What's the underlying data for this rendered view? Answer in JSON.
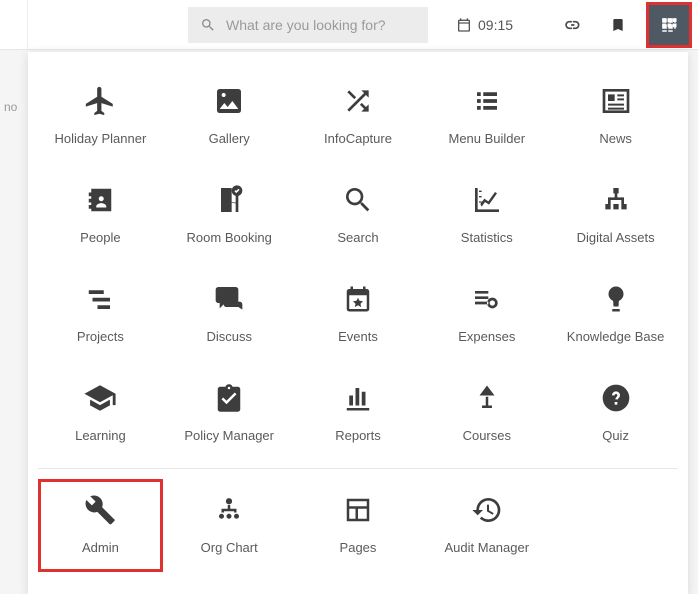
{
  "search": {
    "placeholder": "What are you looking for?"
  },
  "clock": {
    "time": "09:15"
  },
  "sidebar_hint": "no",
  "apps": {
    "row1": [
      {
        "key": "holiday-planner",
        "label": "Holiday Planner"
      },
      {
        "key": "gallery",
        "label": "Gallery"
      },
      {
        "key": "infocapture",
        "label": "InfoCapture"
      },
      {
        "key": "menu-builder",
        "label": "Menu Builder"
      },
      {
        "key": "news",
        "label": "News"
      }
    ],
    "row2": [
      {
        "key": "people",
        "label": "People"
      },
      {
        "key": "room-booking",
        "label": "Room Booking"
      },
      {
        "key": "search",
        "label": "Search"
      },
      {
        "key": "statistics",
        "label": "Statistics"
      },
      {
        "key": "digital-assets",
        "label": "Digital Assets"
      }
    ],
    "row3": [
      {
        "key": "projects",
        "label": "Projects"
      },
      {
        "key": "discuss",
        "label": "Discuss"
      },
      {
        "key": "events",
        "label": "Events"
      },
      {
        "key": "expenses",
        "label": "Expenses"
      },
      {
        "key": "knowledge-base",
        "label": "Knowledge Base"
      }
    ],
    "row4": [
      {
        "key": "learning",
        "label": "Learning"
      },
      {
        "key": "policy-manager",
        "label": "Policy Manager"
      },
      {
        "key": "reports",
        "label": "Reports"
      },
      {
        "key": "courses",
        "label": "Courses"
      },
      {
        "key": "quiz",
        "label": "Quiz"
      }
    ],
    "secondary": [
      {
        "key": "admin",
        "label": "Admin",
        "highlighted": true
      },
      {
        "key": "org-chart",
        "label": "Org Chart"
      },
      {
        "key": "pages",
        "label": "Pages"
      },
      {
        "key": "audit-manager",
        "label": "Audit Manager"
      }
    ]
  }
}
